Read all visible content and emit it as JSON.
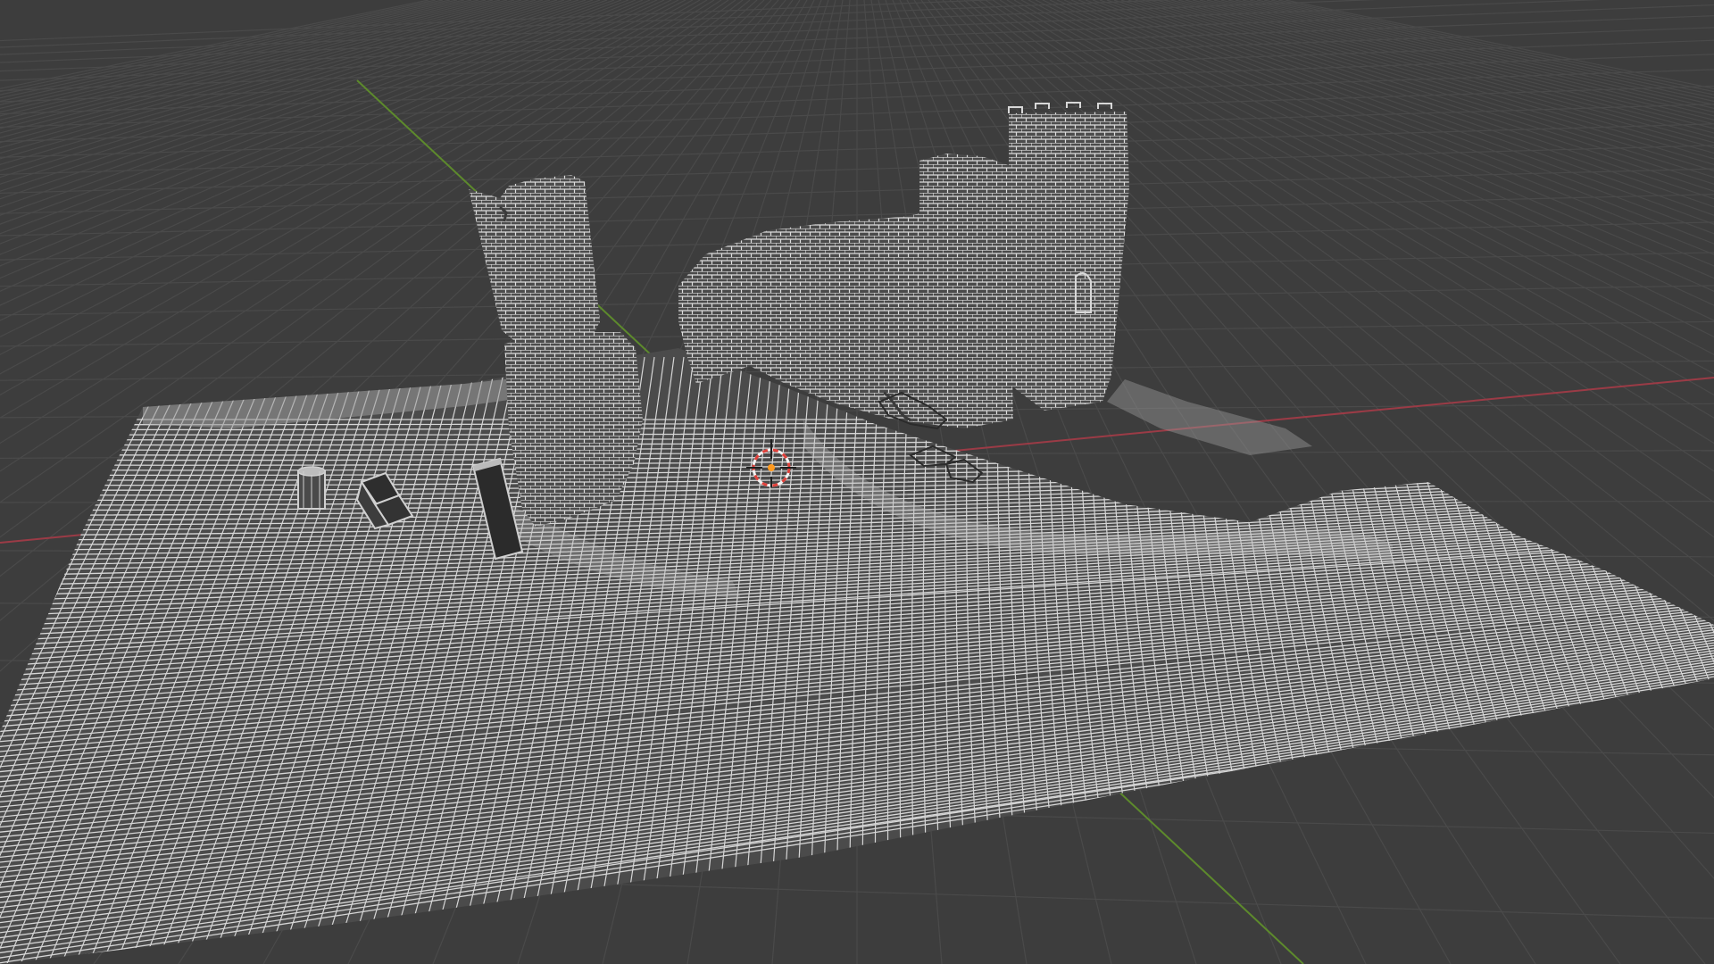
{
  "viewport": {
    "background": "#3d3d3d",
    "grid_color": "#4a4a4a",
    "grid_major_color": "#555555",
    "x_axis_color": "#9b3b46",
    "y_axis_color": "#5d8a2c",
    "wire_color": "#d6d6d6",
    "wire_dim_color": "#bdbdbd",
    "cursor_red": "#e0403a",
    "cursor_white": "#f2f2f2",
    "origin_color": "#ff9a1f"
  },
  "scene": {
    "objects": [
      "terrain-mesh",
      "left-round-tower",
      "right-round-tower",
      "small-back-tower",
      "curtain-wall",
      "lower-left-tower-base",
      "debris-boxes",
      "fallen-pillar",
      "small-cylinder",
      "rubble-pile"
    ]
  },
  "cursor": {
    "icon": "3d-cursor-icon"
  }
}
